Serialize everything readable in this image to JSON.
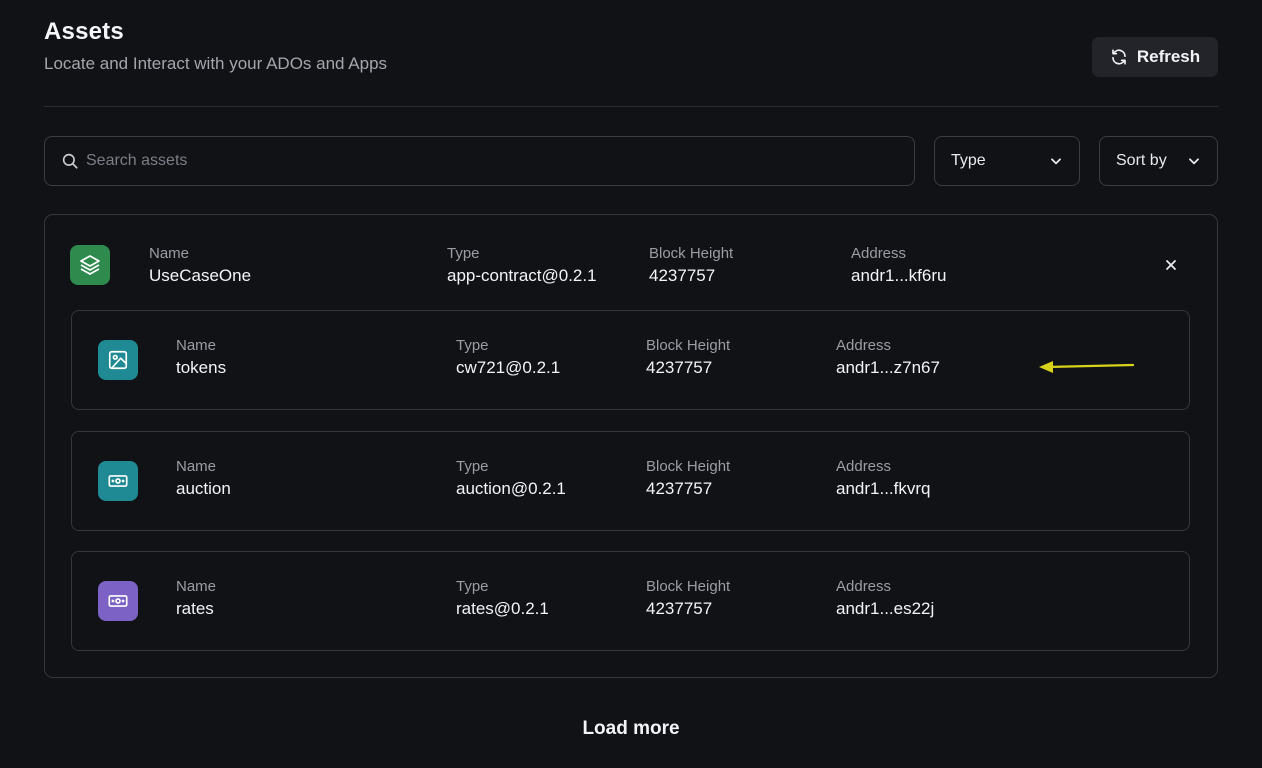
{
  "header": {
    "title": "Assets",
    "subtitle": "Locate and Interact with your ADOs and Apps",
    "refresh_label": "Refresh"
  },
  "filters": {
    "search_placeholder": "Search assets",
    "type_label": "Type",
    "sort_label": "Sort by"
  },
  "app": {
    "icon": "layers-icon",
    "icon_color": "#2f8a4e",
    "name_label": "Name",
    "name": "UseCaseOne",
    "type_label": "Type",
    "type": "app-contract@0.2.1",
    "block_label": "Block Height",
    "block_height": "4237757",
    "address_label": "Address",
    "address": "andr1...kf6ru",
    "children": [
      {
        "icon": "image-icon",
        "icon_color": "#1f8a93",
        "name_label": "Name",
        "name": "tokens",
        "type_label": "Type",
        "type": "cw721@0.2.1",
        "block_label": "Block Height",
        "block_height": "4237757",
        "address_label": "Address",
        "address": "andr1...z7n67"
      },
      {
        "icon": "cash-icon",
        "icon_color": "#1f8a93",
        "name_label": "Name",
        "name": "auction",
        "type_label": "Type",
        "type": "auction@0.2.1",
        "block_label": "Block Height",
        "block_height": "4237757",
        "address_label": "Address",
        "address": "andr1...fkvrq"
      },
      {
        "icon": "cash-icon",
        "icon_color": "#7b62c4",
        "name_label": "Name",
        "name": "rates",
        "type_label": "Type",
        "type": "rates@0.2.1",
        "block_label": "Block Height",
        "block_height": "4237757",
        "address_label": "Address",
        "address": "andr1...es22j"
      }
    ]
  },
  "annotation": {
    "arrow_color": "#d9d21a"
  },
  "footer": {
    "load_more_label": "Load more"
  }
}
